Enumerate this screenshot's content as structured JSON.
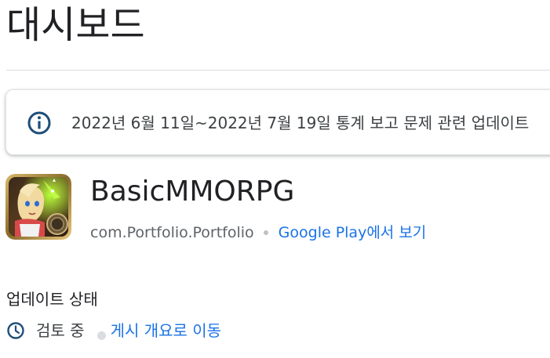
{
  "page": {
    "title": "대시보드"
  },
  "notice": {
    "icon": "info-icon",
    "text": "2022년 6월 11일~2022년 7월 19일 통계 보고 문제 관련 업데이트",
    "icon_color": "#1f4e79"
  },
  "app": {
    "icon": "app-icon-image",
    "name": "BasicMMORPG",
    "package": "com.Portfolio.Portfolio",
    "store_link_label": "Google Play에서 보기",
    "link_color": "#1a73e8"
  },
  "update_status": {
    "title": "업데이트 상태",
    "icon": "clock-icon",
    "status": "검토 중",
    "overview_link": "게시 개요로 이동"
  }
}
